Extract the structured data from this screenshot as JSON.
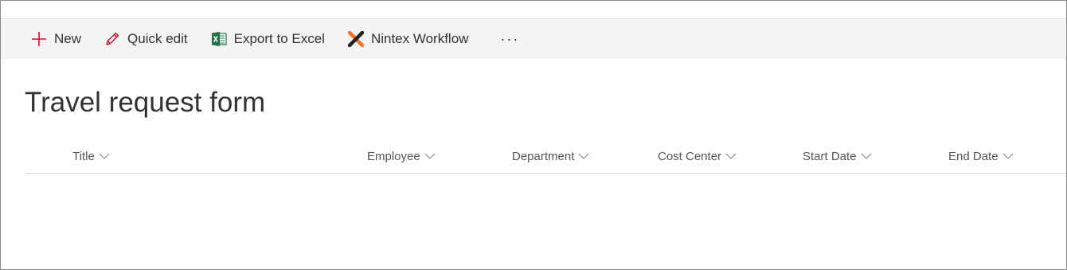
{
  "toolbar": {
    "new_label": "New",
    "quick_edit_label": "Quick edit",
    "export_label": "Export to Excel",
    "nintex_label": "Nintex Workflow",
    "more_label": "···"
  },
  "page": {
    "title": "Travel request form"
  },
  "columns": [
    {
      "label": "Title"
    },
    {
      "label": "Employee"
    },
    {
      "label": "Department"
    },
    {
      "label": "Cost Center"
    },
    {
      "label": "Start Date"
    },
    {
      "label": "End Date"
    }
  ],
  "colors": {
    "accent_red": "#c8102e",
    "excel_green": "#217346",
    "nintex_orange": "#f47321",
    "toolbar_bg": "#f4f4f4",
    "text": "#333333"
  },
  "icons": {
    "new": "plus-icon",
    "quick_edit": "pencil-icon",
    "export": "excel-icon",
    "nintex": "nintex-logo-icon",
    "column_menu": "chevron-down-icon"
  }
}
